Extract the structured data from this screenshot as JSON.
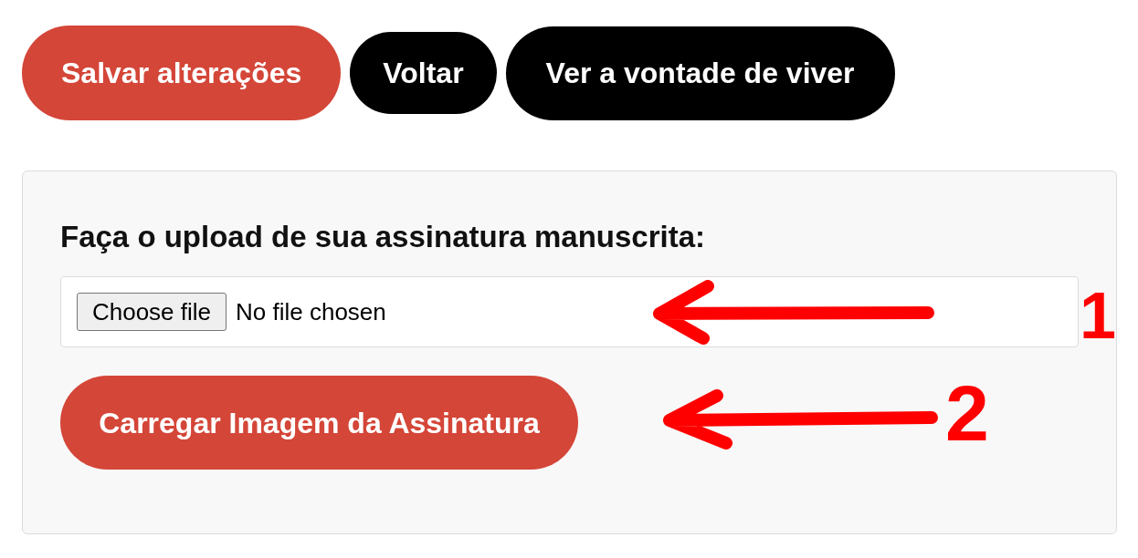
{
  "actions": [
    {
      "label": "Salvar alterações",
      "kind": "primary"
    },
    {
      "label": "Voltar",
      "kind": "back"
    },
    {
      "label": "Ver a vontade de viver",
      "kind": "dark"
    }
  ],
  "upload_panel": {
    "heading": "Faça o upload de sua assinatura manuscrita:",
    "file_input": {
      "button": "Choose file",
      "status": "No file chosen"
    },
    "submit": "Carregar Imagem da Assinatura"
  },
  "annotations": [
    {
      "label": "1"
    },
    {
      "label": "2"
    }
  ]
}
